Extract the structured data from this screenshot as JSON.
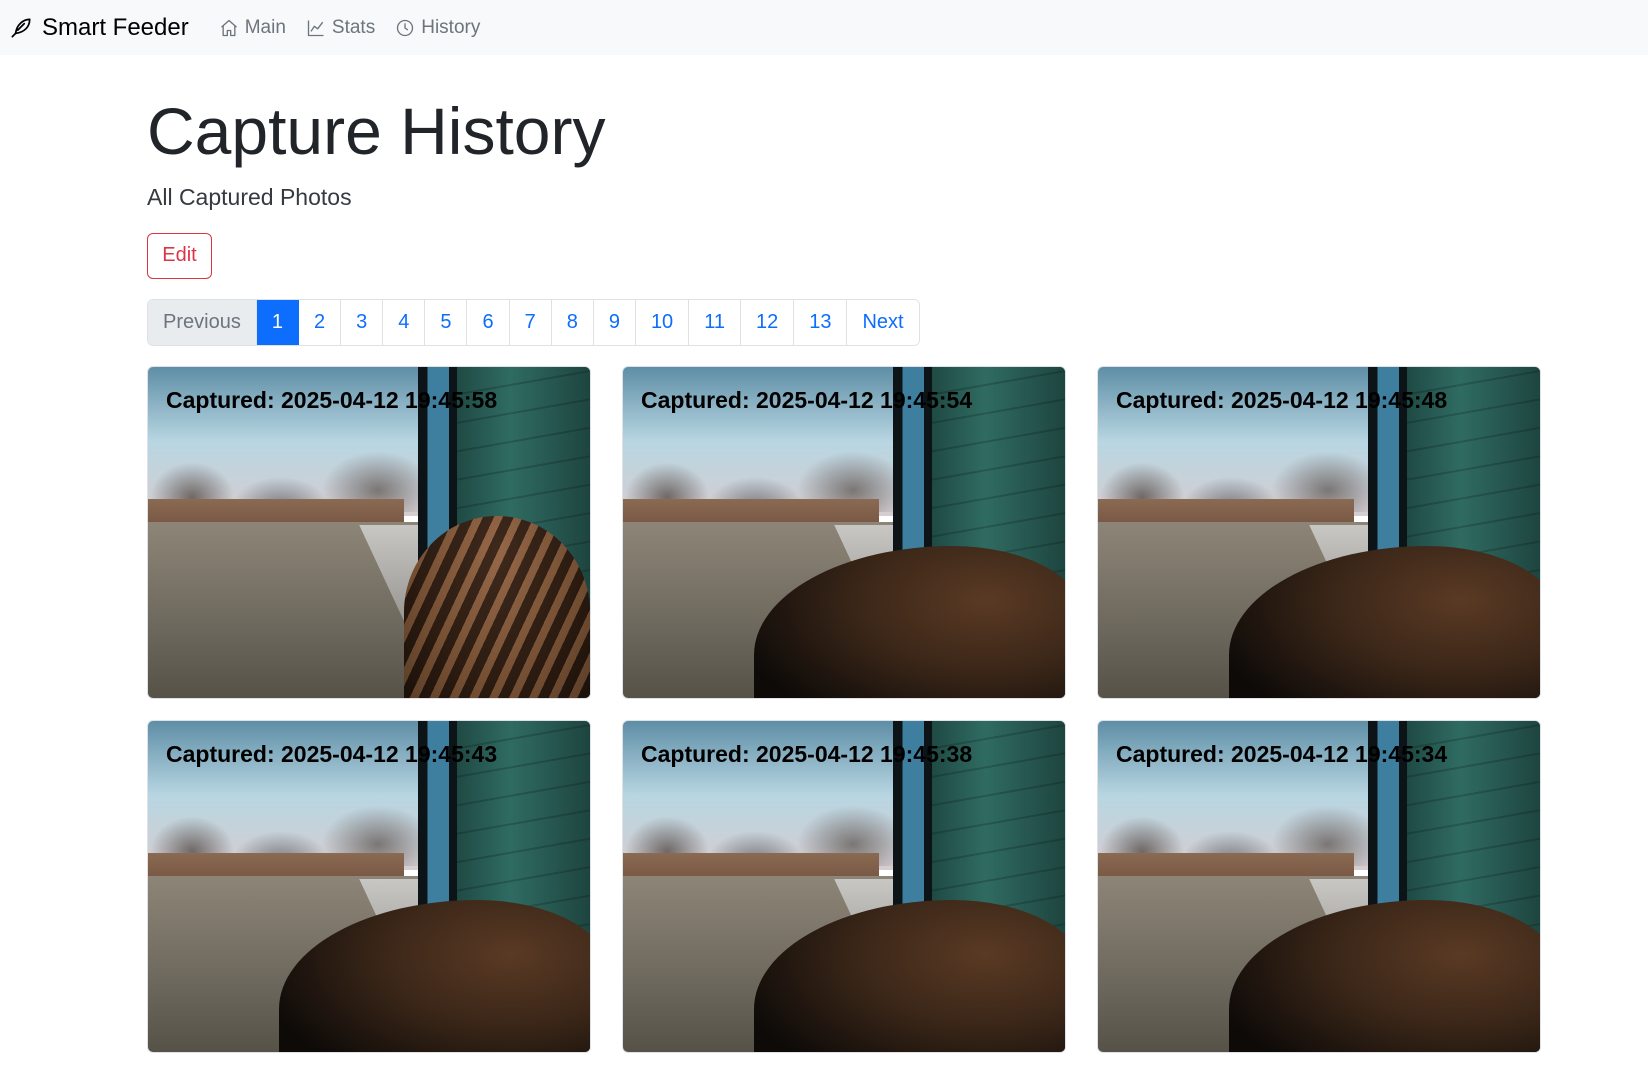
{
  "navbar": {
    "brand": "Smart Feeder",
    "brand_icon": "feather-icon",
    "links": [
      {
        "label": "Main",
        "icon": "house-icon"
      },
      {
        "label": "Stats",
        "icon": "graph-icon"
      },
      {
        "label": "History",
        "icon": "clock-icon"
      }
    ]
  },
  "page": {
    "title": "Capture History",
    "subtitle": "All Captured Photos",
    "edit_label": "Edit"
  },
  "pagination": {
    "previous": "Previous",
    "pages": [
      "1",
      "2",
      "3",
      "4",
      "5",
      "6",
      "7",
      "8",
      "9",
      "10",
      "11",
      "12",
      "13"
    ],
    "current": "1",
    "next": "Next"
  },
  "photos": [
    {
      "caption": "Captured: 2025-04-12 19:45:58"
    },
    {
      "caption": "Captured: 2025-04-12 19:45:54"
    },
    {
      "caption": "Captured: 2025-04-12 19:45:48"
    },
    {
      "caption": "Captured: 2025-04-12 19:45:43"
    },
    {
      "caption": "Captured: 2025-04-12 19:45:38"
    },
    {
      "caption": "Captured: 2025-04-12 19:45:34"
    }
  ],
  "colors": {
    "primary": "#0d6efd",
    "danger": "#dc3545",
    "navbar_bg": "#f8f9fa"
  }
}
